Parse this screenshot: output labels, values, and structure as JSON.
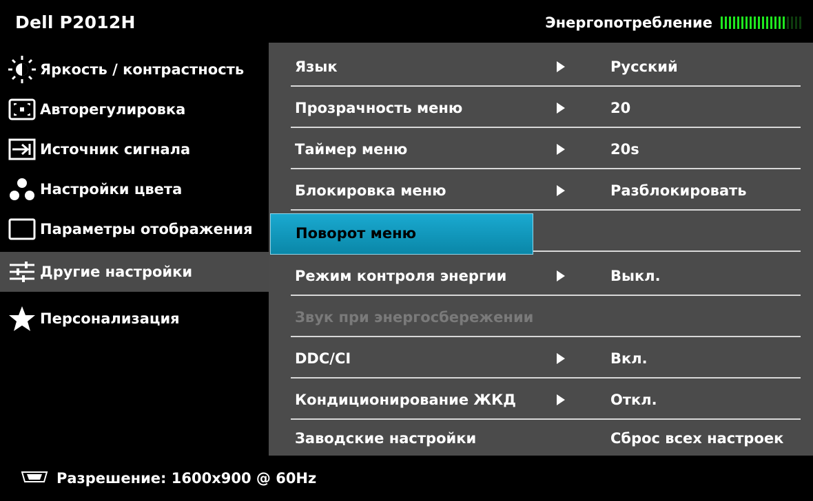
{
  "header": {
    "title": "Dell P2012H",
    "energy_label": "Энергопотребление",
    "energy_level": 0.8
  },
  "menu": {
    "items": [
      {
        "label": "Яркость / контрастность",
        "icon": "brightness-icon"
      },
      {
        "label": "Авторегулировка",
        "icon": "auto-adjust-icon"
      },
      {
        "label": "Источник сигнала",
        "icon": "input-source-icon"
      },
      {
        "label": "Настройки цвета",
        "icon": "color-settings-icon"
      },
      {
        "label": "Параметры отображения",
        "icon": "display-settings-icon"
      },
      {
        "label": "Другие настройки",
        "icon": "sliders-icon",
        "active": true
      },
      {
        "label": "Персонализация",
        "icon": "star-icon"
      }
    ]
  },
  "settings": {
    "rows": [
      {
        "label": "Язык",
        "arrow": true,
        "value": "Русский"
      },
      {
        "label": "Прозрачность меню",
        "arrow": true,
        "value": "20"
      },
      {
        "label": "Таймер меню",
        "arrow": true,
        "value": "20s"
      },
      {
        "label": "Блокировка меню",
        "arrow": true,
        "value": "Разблокировать"
      },
      {
        "label": "Поворот меню",
        "arrow": false,
        "value": "",
        "selected": true
      },
      {
        "label": "Режим контроля энергии",
        "arrow": true,
        "value": "Выкл."
      },
      {
        "label": "Звук при энергосбережении",
        "arrow": false,
        "value": "",
        "disabled": true
      },
      {
        "label": "DDC/CI",
        "arrow": true,
        "value": "Вкл."
      },
      {
        "label": "Кондиционирование ЖКД",
        "arrow": true,
        "value": "Откл."
      },
      {
        "label": "Заводские настройки",
        "arrow": false,
        "value": "Сброс всех настроек"
      }
    ]
  },
  "footer": {
    "resolution_text": "Разрешение: 1600x900 @ 60Hz"
  },
  "colors": {
    "highlight": "#1aa9d0",
    "energy_on": "#1fe81f",
    "panel": "#4b4b4b"
  }
}
